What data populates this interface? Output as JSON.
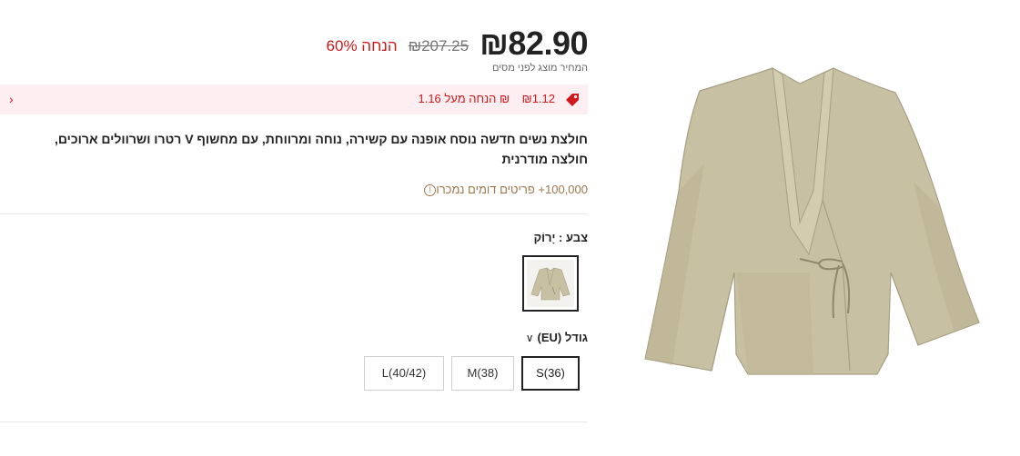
{
  "price": {
    "current": "₪82.90",
    "original": "₪207.25",
    "discount": "60% הנחה",
    "tax_note": "המחיר מוצג לפני מסים"
  },
  "promo": {
    "amount": "₪1.12",
    "text": "₪ הנחה מעל 1.16",
    "icon": "tag-icon",
    "accent_color": "#d0191b",
    "background_color": "#fdeff1"
  },
  "product": {
    "title": "חולצת נשים חדשה נוסח אופנה עם קשירה, נוחה ומרווחת, עם מחשוף V רטרו ושרוולים ארוכים, חולצה מודרנית",
    "sold": "100,000+ פריטים דומים נמכרו"
  },
  "color": {
    "label": "צבע : יָרוֹק",
    "selected_swatch": "green-blouse-swatch"
  },
  "size": {
    "label": "גודל (EU)",
    "options": [
      {
        "label": "S(36)",
        "selected": true
      },
      {
        "label": "M(38)",
        "selected": false
      },
      {
        "label": "L(40/42)",
        "selected": false
      }
    ]
  }
}
